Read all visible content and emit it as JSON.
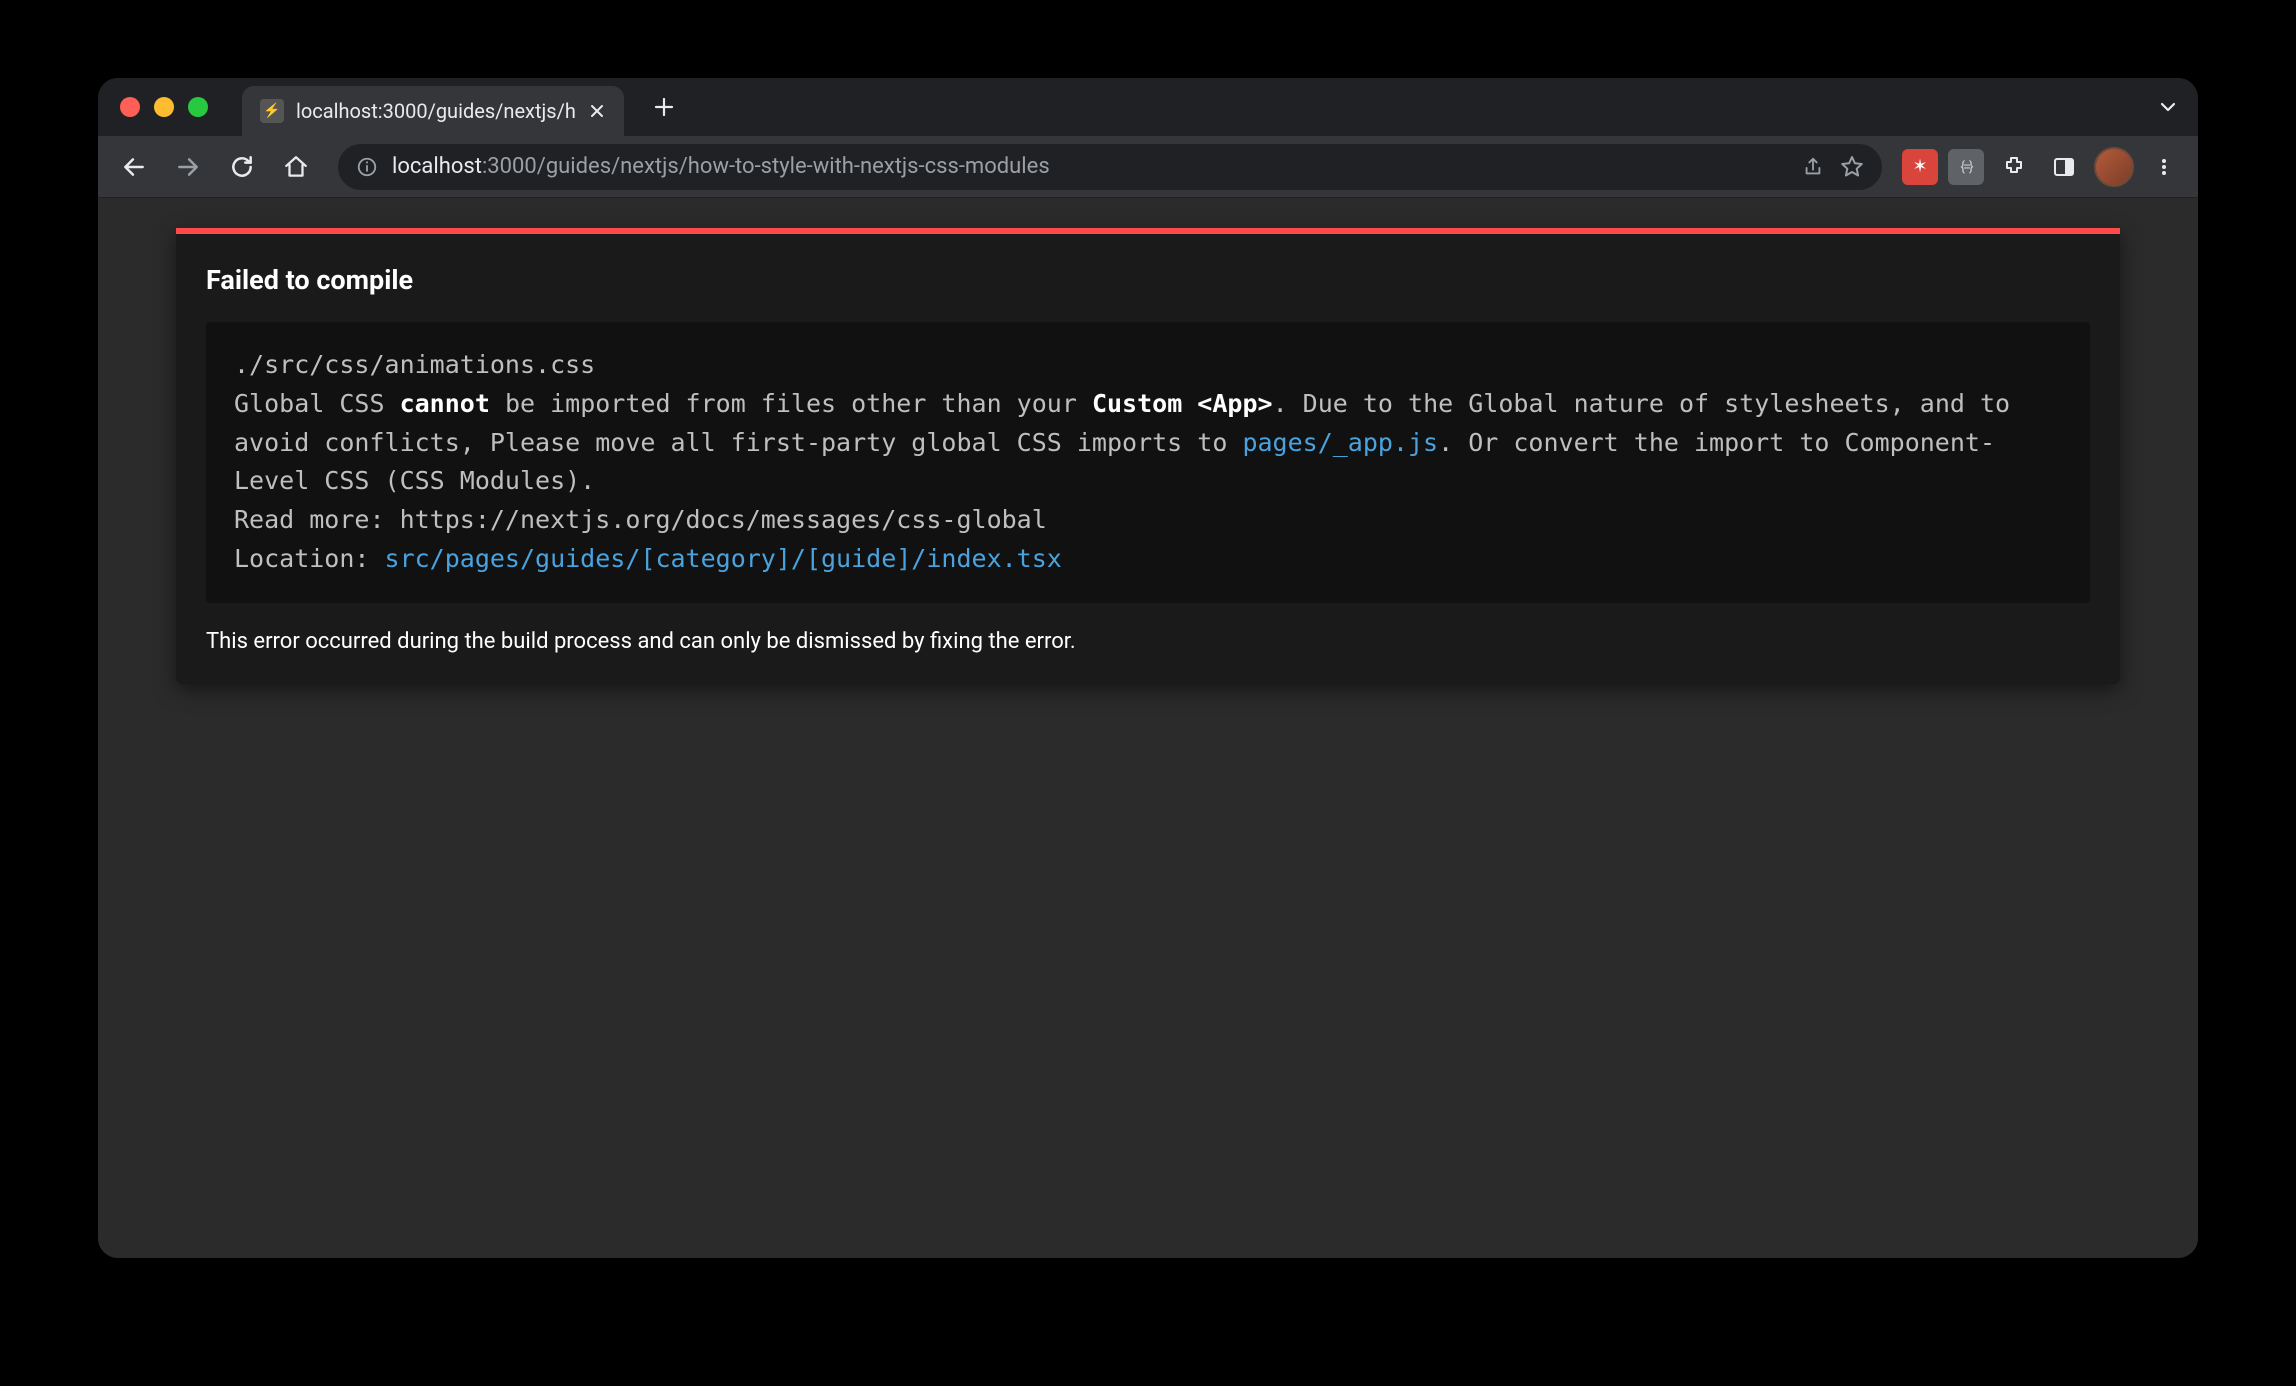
{
  "browser": {
    "tab": {
      "title": "localhost:3000/guides/nextjs/h"
    },
    "url": {
      "host": "localhost",
      "rest": ":3000/guides/nextjs/how-to-style-with-nextjs-css-modules"
    }
  },
  "error": {
    "heading": "Failed to compile",
    "file": "./src/css/animations.css",
    "msg_pre": "Global CSS ",
    "msg_cannot": "cannot",
    "msg_mid1": " be imported from files other than your ",
    "msg_custom_app": "Custom <App>",
    "msg_mid2": ". Due to the Global nature of stylesheets, and to avoid conflicts, Please move all first-party global CSS imports to ",
    "msg_pages_app": "pages/_app.js",
    "msg_mid3": ". Or convert the import to Component-Level CSS (CSS Modules).",
    "readmore_label": "Read more: ",
    "readmore_url": "https://nextjs.org/docs/messages/css-global",
    "location_label": "Location: ",
    "location_path": "src/pages/guides/[category]/[guide]/index.tsx",
    "footer": "This error occurred during the build process and can only be dismissed by fixing the error."
  }
}
